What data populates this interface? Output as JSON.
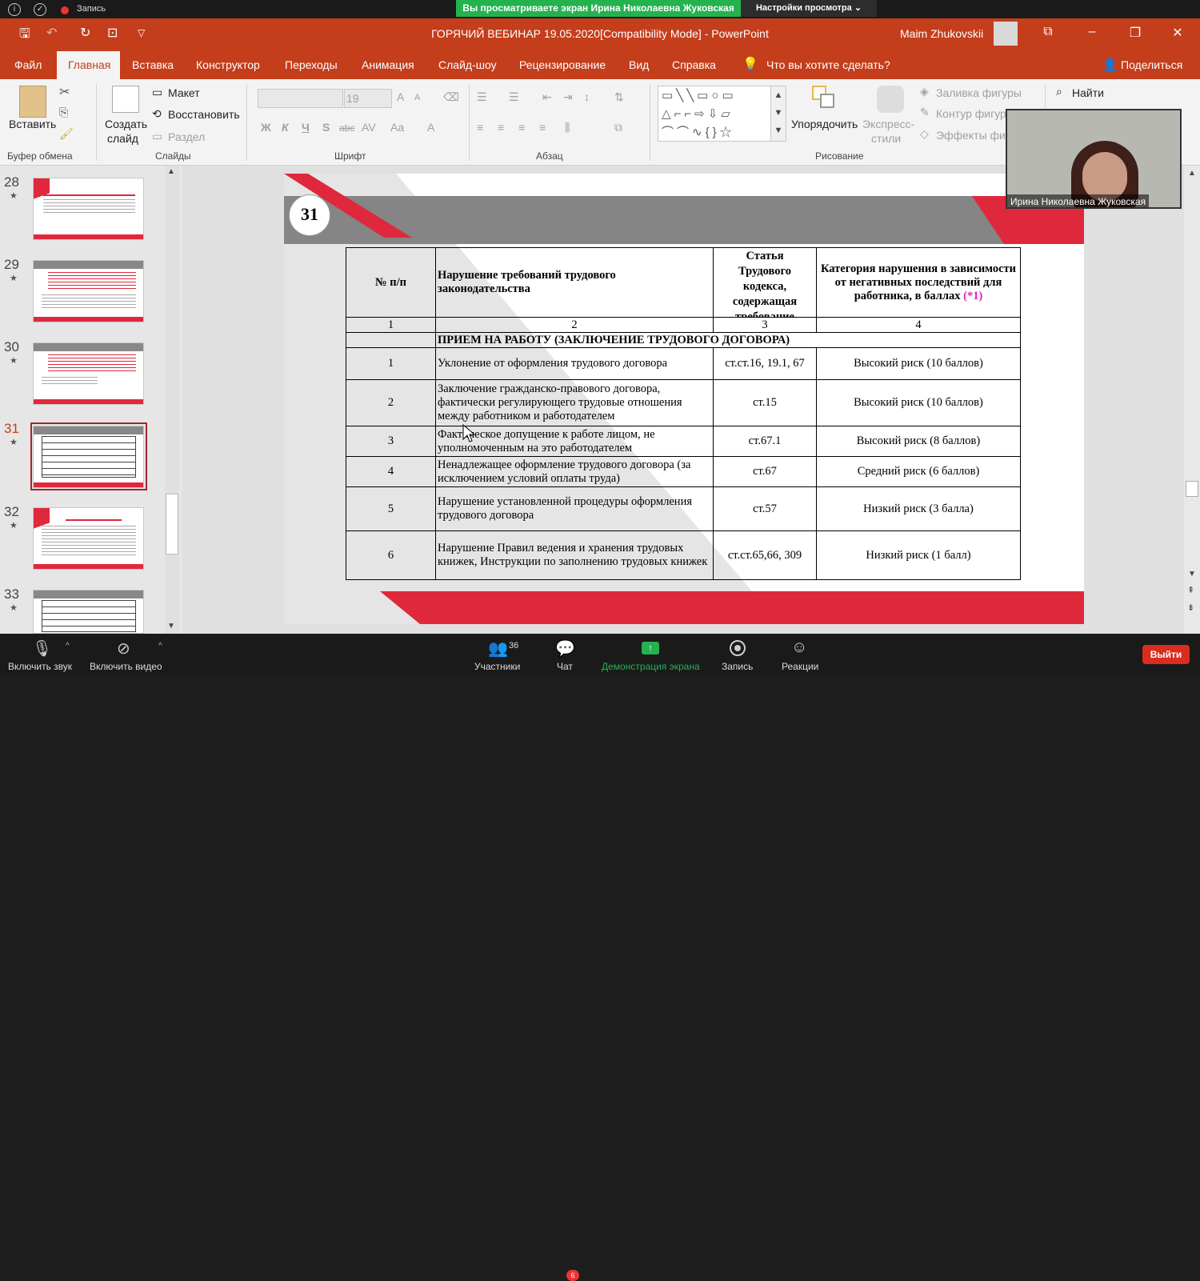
{
  "zoom_top": {
    "recording_label": "Запись",
    "share_banner": "Вы просматриваете экран Ирина Николаевна Жуковская",
    "view_options": "Настройки просмотра ⌄"
  },
  "titlebar": {
    "title": "ГОРЯЧИЙ ВЕБИНАР 19.05.2020[Compatibility Mode]  -  PowerPoint",
    "user": "Maim Zhukovskii"
  },
  "tabs": [
    "Файл",
    "Главная",
    "Вставка",
    "Конструктор",
    "Переходы",
    "Анимация",
    "Слайд-шоу",
    "Рецензирование",
    "Вид",
    "Справка"
  ],
  "tell_me": "Что вы хотите сделать?",
  "share": "Поделиться",
  "ribbon": {
    "paste": "Вставить",
    "new_slide_1": "Создать",
    "new_slide_2": "слайд",
    "layout": "Макет",
    "reset": "Восстановить",
    "section": "Раздел",
    "font_size": "19",
    "arrange": "Упорядочить",
    "quick_styles_1": "Экспресс-",
    "quick_styles_2": "стили",
    "shape_fill": "Заливка фигуры",
    "shape_outline": "Контур фигур",
    "shape_effects": "Эффекты фиг",
    "find": "Найти",
    "groups": {
      "clipboard": "Буфер обмена",
      "slides": "Слайды",
      "font": "Шрифт",
      "paragraph": "Абзац",
      "drawing": "Рисование"
    }
  },
  "font_buttons": {
    "bold": "Ж",
    "italic": "К",
    "underline": "Ч",
    "shadow": "S",
    "strike": "abc",
    "spacing": "AV",
    "case": "Aa",
    "color": "A",
    "grow": "A",
    "shrink": "A"
  },
  "thumbnails": [
    {
      "num": "28"
    },
    {
      "num": "29"
    },
    {
      "num": "30"
    },
    {
      "num": "31"
    },
    {
      "num": "32"
    },
    {
      "num": "33"
    }
  ],
  "slide": {
    "number": "31",
    "headers": {
      "h1": "№ п/п",
      "h2": "Нарушение требований трудового законодательства",
      "h3_a": "Статья",
      "h3_b": "Трудового",
      "h3_c": "кодекса,",
      "h3_d": "содержащая",
      "h3_e": "требование",
      "h4": "Категория нарушения в зависимости от негативных последствий для работника, в баллах ",
      "h4_note": "(*1)"
    },
    "col_nums": [
      "1",
      "2",
      "3",
      "4"
    ],
    "section": "ПРИЕМ НА РАБОТУ (ЗАКЛЮЧЕНИЕ ТРУДОВОГО ДОГОВОРА)",
    "rows": [
      {
        "n": "1",
        "violation": "Уклонение от оформления трудового договора",
        "article": "ст.ст.16, 19.1, 67",
        "category": "Высокий риск  (10 баллов)"
      },
      {
        "n": "2",
        "violation": "Заключение гражданско-правового договора, фактически регулирующего трудовые отношения между работником и работодателем",
        "article": "ст.15",
        "category": "Высокий риск  (10 баллов)"
      },
      {
        "n": "3",
        "violation": "Фактическое допущение к работе лицом, не уполномоченным на это работодателем",
        "article": "ст.67.1",
        "category": "Высокий риск   (8 баллов)"
      },
      {
        "n": "4",
        "violation": "Ненадлежащее оформление трудового договора (за исключением условий оплаты труда)",
        "article": "ст.67",
        "category": "Средний риск  (6 баллов)"
      },
      {
        "n": "5",
        "violation": "Нарушение установленной процедуры оформления трудового договора",
        "article": "ст.57",
        "category": "Низкий риск   (3 балла)"
      },
      {
        "n": "6",
        "violation": "Нарушение Правил ведения и хранения трудовых книжек, Инструкции по заполнению трудовых книжек",
        "article": "ст.ст.65,66, 309",
        "category": "Низкий риск  (1 балл)"
      }
    ]
  },
  "camera": {
    "name": "Ирина Николаевна Жуковская"
  },
  "zoom_bottom": {
    "mute": "Включить звук",
    "video": "Включить видео",
    "participants": "Участники",
    "participants_count": "36",
    "chat": "Чат",
    "chat_badge": "6",
    "share_screen": "Демонстрация экрана",
    "record": "Запись",
    "reactions": "Реакции",
    "leave": "Выйти"
  },
  "colors": {
    "accent": "#c43e1c",
    "slide_red": "#e0283c",
    "slide_gray": "#858585",
    "share_green": "#24b24f"
  }
}
